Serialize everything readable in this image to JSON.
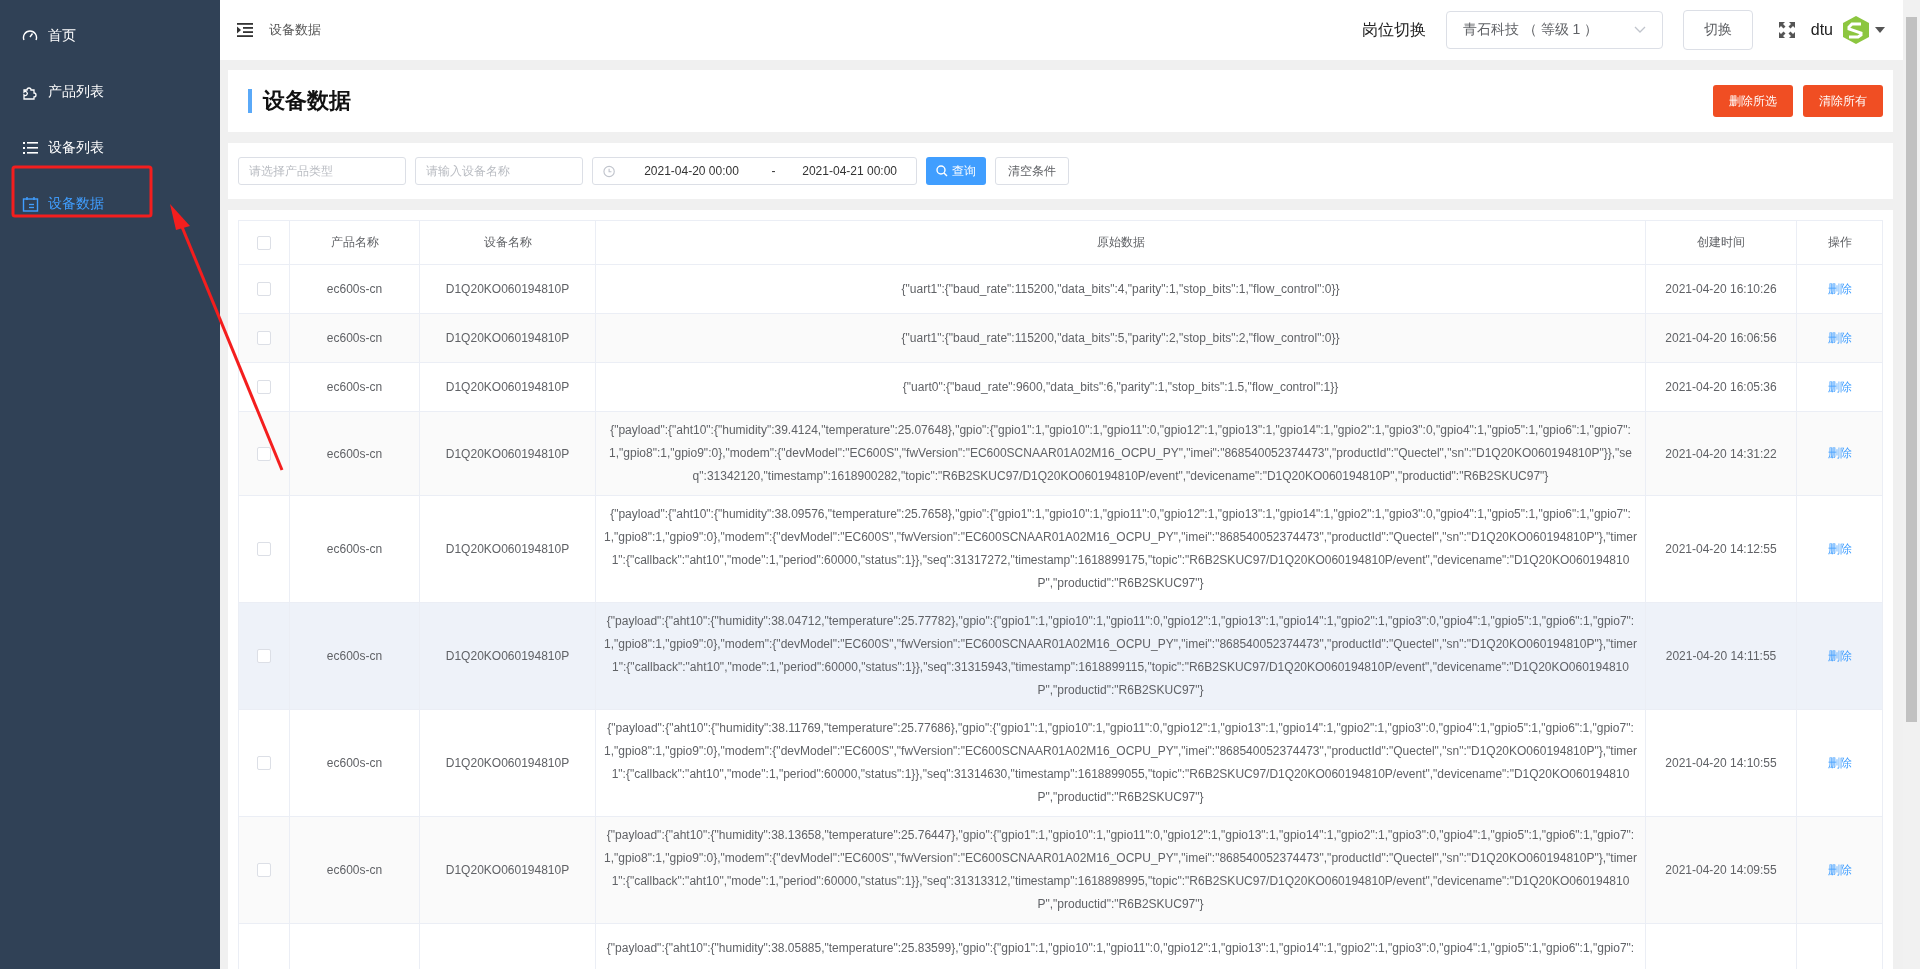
{
  "sidebar": {
    "items": [
      {
        "kind": "dashboard",
        "label": "首页",
        "selected": false
      },
      {
        "kind": "puzzle",
        "label": "产品列表",
        "selected": false
      },
      {
        "kind": "list",
        "label": "设备列表",
        "selected": false
      },
      {
        "kind": "calendar",
        "label": "设备数据",
        "selected": true
      }
    ]
  },
  "header": {
    "breadcrumb": "设备数据",
    "role_label": "岗位切换",
    "role_select": {
      "value": "青石科技 （ 等级 1 ）"
    },
    "switch_button": "切换",
    "username": "dtu"
  },
  "page_title": "设备数据",
  "actions": [
    "删除所选",
    "清除所有"
  ],
  "filters": {
    "product_type": {
      "placeholder": "请选择产品类型"
    },
    "device_name": {
      "placeholder": "请输入设备名称"
    },
    "date_range": {
      "start": "2021-04-20 00:00",
      "separator": "-",
      "end": "2021-04-21 00:00"
    },
    "search_button": "查询",
    "clear_button": "清空条件"
  },
  "table": {
    "header_checked": false,
    "columns": [
      "产品名称",
      "设备名称",
      "原始数据",
      "创建时间",
      "操作"
    ],
    "rows": [
      {
        "checked": false,
        "highlighted": false,
        "product": "ec600s-cn",
        "device": "D1Q20KO060194810P",
        "raw_data": "{\"uart1\":{\"baud_rate\":115200,\"data_bits\":4,\"parity\":1,\"stop_bits\":1,\"flow_control\":0}}",
        "created": "2021-04-20 16:10:26",
        "action": "删除"
      },
      {
        "checked": false,
        "highlighted": false,
        "product": "ec600s-cn",
        "device": "D1Q20KO060194810P",
        "raw_data": "{\"uart1\":{\"baud_rate\":115200,\"data_bits\":5,\"parity\":2,\"stop_bits\":2,\"flow_control\":0}}",
        "created": "2021-04-20 16:06:56",
        "action": "删除"
      },
      {
        "checked": false,
        "highlighted": false,
        "product": "ec600s-cn",
        "device": "D1Q20KO060194810P",
        "raw_data": "{\"uart0\":{\"baud_rate\":9600,\"data_bits\":6,\"parity\":1,\"stop_bits\":1.5,\"flow_control\":1}}",
        "created": "2021-04-20 16:05:36",
        "action": "删除"
      },
      {
        "checked": false,
        "highlighted": false,
        "product": "ec600s-cn",
        "device": "D1Q20KO060194810P",
        "raw_data": "{\"payload\":{\"aht10\":{\"humidity\":39.4124,\"temperature\":25.07648},\"gpio\":{\"gpio1\":1,\"gpio10\":1,\"gpio11\":0,\"gpio12\":1,\"gpio13\":1,\"gpio14\":1,\"gpio2\":1,\"gpio3\":0,\"gpio4\":1,\"gpio5\":1,\"gpio6\":1,\"gpio7\":1,\"gpio8\":1,\"gpio9\":0},\"modem\":{\"devModel\":\"EC600S\",\"fwVersion\":\"EC600SCNAAR01A02M16_OCPU_PY\",\"imei\":\"868540052374473\",\"productId\":\"Quectel\",\"sn\":\"D1Q20KO060194810P\"}},\"seq\":31342120,\"timestamp\":1618900282,\"topic\":\"R6B2SKUC97/D1Q20KO060194810P/event\",\"devicename\":\"D1Q20KO060194810P\",\"productid\":\"R6B2SKUC97\"}",
        "created": "2021-04-20 14:31:22",
        "action": "删除"
      },
      {
        "checked": false,
        "highlighted": false,
        "product": "ec600s-cn",
        "device": "D1Q20KO060194810P",
        "raw_data": "{\"payload\":{\"aht10\":{\"humidity\":38.09576,\"temperature\":25.7658},\"gpio\":{\"gpio1\":1,\"gpio10\":1,\"gpio11\":0,\"gpio12\":1,\"gpio13\":1,\"gpio14\":1,\"gpio2\":1,\"gpio3\":0,\"gpio4\":1,\"gpio5\":1,\"gpio6\":1,\"gpio7\":1,\"gpio8\":1,\"gpio9\":0},\"modem\":{\"devModel\":\"EC600S\",\"fwVersion\":\"EC600SCNAAR01A02M16_OCPU_PY\",\"imei\":\"868540052374473\",\"productId\":\"Quectel\",\"sn\":\"D1Q20KO060194810P\"},\"timer1\":{\"callback\":\"aht10\",\"mode\":1,\"period\":60000,\"status\":1}},\"seq\":31317272,\"timestamp\":1618899175,\"topic\":\"R6B2SKUC97/D1Q20KO060194810P/event\",\"devicename\":\"D1Q20KO060194810P\",\"productid\":\"R6B2SKUC97\"}",
        "created": "2021-04-20 14:12:55",
        "action": "删除"
      },
      {
        "checked": false,
        "highlighted": true,
        "product": "ec600s-cn",
        "device": "D1Q20KO060194810P",
        "raw_data": "{\"payload\":{\"aht10\":{\"humidity\":38.04712,\"temperature\":25.77782},\"gpio\":{\"gpio1\":1,\"gpio10\":1,\"gpio11\":0,\"gpio12\":1,\"gpio13\":1,\"gpio14\":1,\"gpio2\":1,\"gpio3\":0,\"gpio4\":1,\"gpio5\":1,\"gpio6\":1,\"gpio7\":1,\"gpio8\":1,\"gpio9\":0},\"modem\":{\"devModel\":\"EC600S\",\"fwVersion\":\"EC600SCNAAR01A02M16_OCPU_PY\",\"imei\":\"868540052374473\",\"productId\":\"Quectel\",\"sn\":\"D1Q20KO060194810P\"},\"timer1\":{\"callback\":\"aht10\",\"mode\":1,\"period\":60000,\"status\":1}},\"seq\":31315943,\"timestamp\":1618899115,\"topic\":\"R6B2SKUC97/D1Q20KO060194810P/event\",\"devicename\":\"D1Q20KO060194810P\",\"productid\":\"R6B2SKUC97\"}",
        "created": "2021-04-20 14:11:55",
        "action": "删除"
      },
      {
        "checked": false,
        "highlighted": false,
        "product": "ec600s-cn",
        "device": "D1Q20KO060194810P",
        "raw_data": "{\"payload\":{\"aht10\":{\"humidity\":38.11769,\"temperature\":25.77686},\"gpio\":{\"gpio1\":1,\"gpio10\":1,\"gpio11\":0,\"gpio12\":1,\"gpio13\":1,\"gpio14\":1,\"gpio2\":1,\"gpio3\":0,\"gpio4\":1,\"gpio5\":1,\"gpio6\":1,\"gpio7\":1,\"gpio8\":1,\"gpio9\":0},\"modem\":{\"devModel\":\"EC600S\",\"fwVersion\":\"EC600SCNAAR01A02M16_OCPU_PY\",\"imei\":\"868540052374473\",\"productId\":\"Quectel\",\"sn\":\"D1Q20KO060194810P\"},\"timer1\":{\"callback\":\"aht10\",\"mode\":1,\"period\":60000,\"status\":1}},\"seq\":31314630,\"timestamp\":1618899055,\"topic\":\"R6B2SKUC97/D1Q20KO060194810P/event\",\"devicename\":\"D1Q20KO060194810P\",\"productid\":\"R6B2SKUC97\"}",
        "created": "2021-04-20 14:10:55",
        "action": "删除"
      },
      {
        "checked": false,
        "highlighted": false,
        "product": "ec600s-cn",
        "device": "D1Q20KO060194810P",
        "raw_data": "{\"payload\":{\"aht10\":{\"humidity\":38.13658,\"temperature\":25.76447},\"gpio\":{\"gpio1\":1,\"gpio10\":1,\"gpio11\":0,\"gpio12\":1,\"gpio13\":1,\"gpio14\":1,\"gpio2\":1,\"gpio3\":0,\"gpio4\":1,\"gpio5\":1,\"gpio6\":1,\"gpio7\":1,\"gpio8\":1,\"gpio9\":0},\"modem\":{\"devModel\":\"EC600S\",\"fwVersion\":\"EC600SCNAAR01A02M16_OCPU_PY\",\"imei\":\"868540052374473\",\"productId\":\"Quectel\",\"sn\":\"D1Q20KO060194810P\"},\"timer1\":{\"callback\":\"aht10\",\"mode\":1,\"period\":60000,\"status\":1}},\"seq\":31313312,\"timestamp\":1618898995,\"topic\":\"R6B2SKUC97/D1Q20KO060194810P/event\",\"devicename\":\"D1Q20KO060194810P\",\"productid\":\"R6B2SKUC97\"}",
        "created": "2021-04-20 14:09:55",
        "action": "删除"
      },
      {
        "highlighted": false,
        "raw_data": "{\"payload\":{\"aht10\":{\"humidity\":38.05885,\"temperature\":25.83599},\"gpio\":{\"gpio1\":1,\"gpio10\":1,\"gpio11\":0,\"gpio12\":1,\"gpio13\":1,\"gpio14\":1,\"gpio2\":1,\"gpio3\":0,\"gpio4\":1,\"gpio5\":1,\"gpio6\":1,\"gpio7\":"
      }
    ]
  }
}
